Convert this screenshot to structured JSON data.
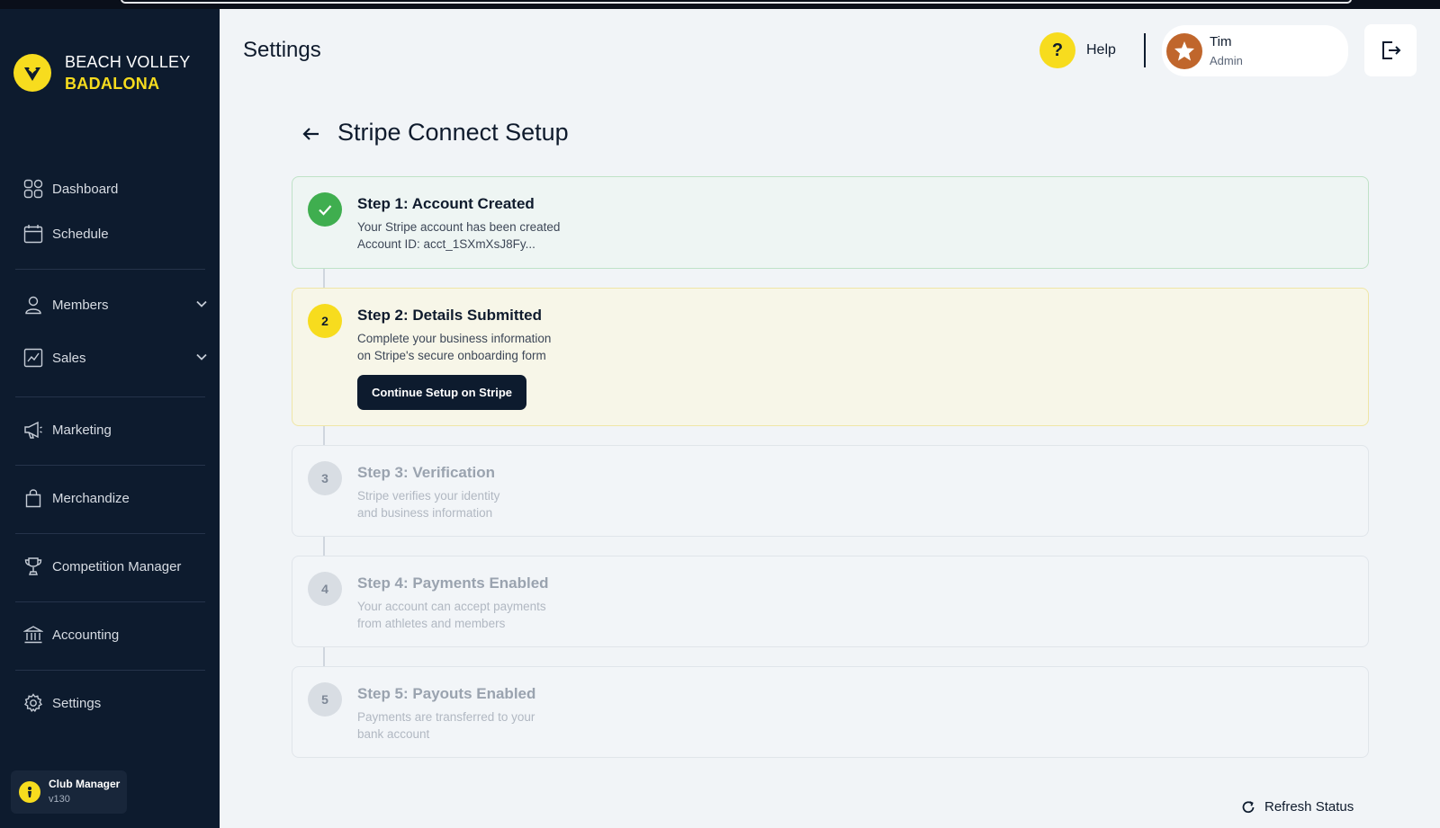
{
  "brand": {
    "line1": "BEACH VOLLEY",
    "line2": "BADALONA",
    "logo_icon": "club-logo-icon"
  },
  "sidebar": {
    "items": [
      {
        "label": "Dashboard",
        "icon": "dashboard-grid-icon"
      },
      {
        "label": "Schedule",
        "icon": "calendar-icon"
      },
      {
        "label": "Members",
        "icon": "user-icon",
        "expandable": true
      },
      {
        "label": "Sales",
        "icon": "chart-icon",
        "expandable": true
      },
      {
        "label": "Marketing",
        "icon": "megaphone-icon"
      },
      {
        "label": "Merchandize",
        "icon": "shopping-bag-icon"
      },
      {
        "label": "Competition Manager",
        "icon": "trophy-icon"
      },
      {
        "label": "Accounting",
        "icon": "bank-icon"
      },
      {
        "label": "Settings",
        "icon": "gear-icon"
      }
    ],
    "app_badge": {
      "name": "Club Manager",
      "version": "v130"
    }
  },
  "header": {
    "title": "Settings",
    "help_label": "Help",
    "help_symbol": "?",
    "user": {
      "name": "Tim",
      "role": "Admin"
    }
  },
  "main": {
    "title": "Stripe Connect Setup",
    "steps": [
      {
        "number": "1",
        "status": "done",
        "title": "Step 1: Account Created",
        "desc_line1": "Your Stripe account has been created",
        "desc_line2": "Account ID: acct_1SXmXsJ8Fy..."
      },
      {
        "number": "2",
        "status": "active",
        "title": "Step 2: Details Submitted",
        "desc_line1": "Complete your business information",
        "desc_line2": "on Stripe's secure onboarding form",
        "button": "Continue Setup on Stripe"
      },
      {
        "number": "3",
        "status": "pending",
        "title": "Step 3: Verification",
        "desc_line1": "Stripe verifies your identity",
        "desc_line2": "and business information"
      },
      {
        "number": "4",
        "status": "pending",
        "title": "Step 4: Payments Enabled",
        "desc_line1": "Your account can accept payments",
        "desc_line2": "from athletes and members"
      },
      {
        "number": "5",
        "status": "pending",
        "title": "Step 5: Payouts Enabled",
        "desc_line1": "Payments are transferred to your",
        "desc_line2": "bank account"
      }
    ],
    "refresh_label": "Refresh Status"
  },
  "colors": {
    "sidebar_bg": "#0d1b2e",
    "accent": "#f7dc1e",
    "success": "#3fae4f",
    "page_bg": "#f1f4f7"
  }
}
